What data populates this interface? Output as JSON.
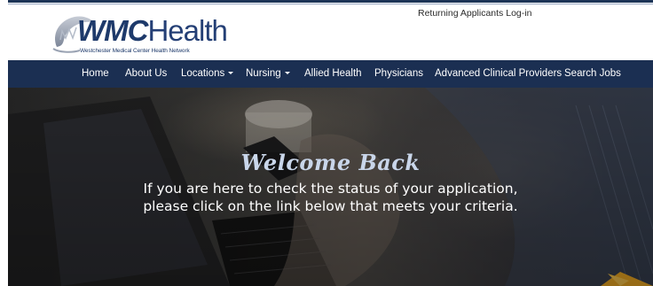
{
  "header": {
    "logo": {
      "wordmark_bold": "WMC",
      "wordmark_thin": "Health",
      "subtitle": "Westchester Medical Center Health Network"
    },
    "login_link": "Returning Applicants Log-in"
  },
  "nav": {
    "items": [
      {
        "label": "Home",
        "dropdown": false
      },
      {
        "label": "About Us",
        "dropdown": false
      },
      {
        "label": "Locations",
        "dropdown": true
      },
      {
        "label": "Nursing",
        "dropdown": true
      },
      {
        "label": "Allied Health",
        "dropdown": false
      },
      {
        "label": "Physicians",
        "dropdown": false
      },
      {
        "label": "Advanced Clinical Providers",
        "dropdown": false
      },
      {
        "label": "Search Jobs",
        "dropdown": false
      }
    ]
  },
  "hero": {
    "title": "Welcome Back",
    "line1": "If you are here to check the status of your application,",
    "line2": "please click on the link below that meets your criteria."
  },
  "colors": {
    "navbar": "#1b2f52",
    "brand": "#1e3a6b",
    "hero_title": "#c9d6ea"
  }
}
